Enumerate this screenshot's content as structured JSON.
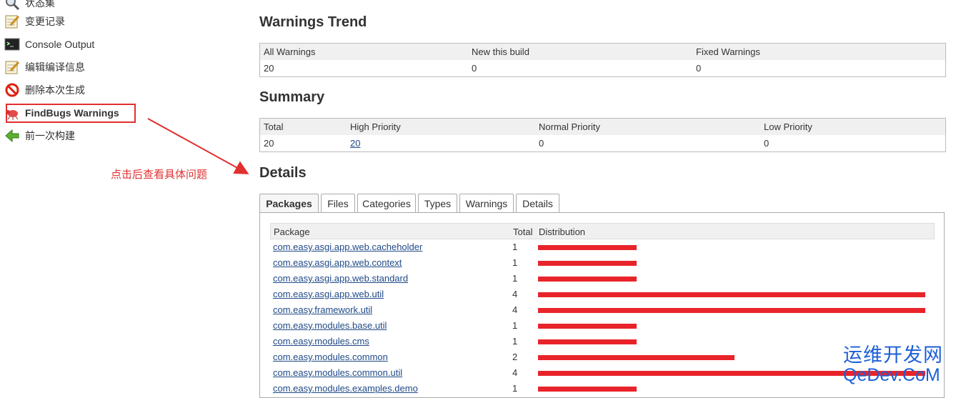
{
  "sidebar": {
    "items": [
      {
        "label": "状态集",
        "icon": "magnifier-icon"
      },
      {
        "label": "变更记录",
        "icon": "notepad-icon"
      },
      {
        "label": "Console Output",
        "icon": "terminal-icon"
      },
      {
        "label": "编辑编译信息",
        "icon": "notepad-icon"
      },
      {
        "label": "删除本次生成",
        "icon": "no-entry-icon"
      },
      {
        "label": "FindBugs Warnings",
        "icon": "bug-icon"
      },
      {
        "label": "前一次构建",
        "icon": "green-left-arrow-icon"
      }
    ],
    "annotation": "点击后查看具体问题",
    "annotation_color": "#e03030"
  },
  "warnings_trend": {
    "title": "Warnings Trend",
    "headers": [
      "All Warnings",
      "New this build",
      "Fixed Warnings"
    ],
    "values": [
      "20",
      "0",
      "0"
    ]
  },
  "summary": {
    "title": "Summary",
    "headers": [
      "Total",
      "High Priority",
      "Normal Priority",
      "Low Priority"
    ],
    "values": [
      "20",
      "20",
      "0",
      "0"
    ]
  },
  "details": {
    "title": "Details",
    "tabs": [
      "Packages",
      "Files",
      "Categories",
      "Types",
      "Warnings",
      "Details"
    ],
    "active_tab": "Packages",
    "table_headers": [
      "Package",
      "Total",
      "Distribution"
    ],
    "max_total": 4,
    "bar_color": "#e8242a",
    "rows": [
      {
        "package": "com.easy.asgi.app.web.cacheholder",
        "total": 1
      },
      {
        "package": "com.easy.asgi.app.web.context",
        "total": 1
      },
      {
        "package": "com.easy.asgi.app.web.standard",
        "total": 1
      },
      {
        "package": "com.easy.asgi.app.web.util",
        "total": 4
      },
      {
        "package": "com.easy.framework.util",
        "total": 4
      },
      {
        "package": "com.easy.modules.base.util",
        "total": 1
      },
      {
        "package": "com.easy.modules.cms",
        "total": 1
      },
      {
        "package": "com.easy.modules.common",
        "total": 2
      },
      {
        "package": "com.easy.modules.common.util",
        "total": 4
      },
      {
        "package": "com.easy.modules.examples.demo",
        "total": 1
      }
    ]
  },
  "watermark": {
    "line1": "运维开发网",
    "line2": "QeDev.CoM",
    "color": "#1c5fd6"
  }
}
